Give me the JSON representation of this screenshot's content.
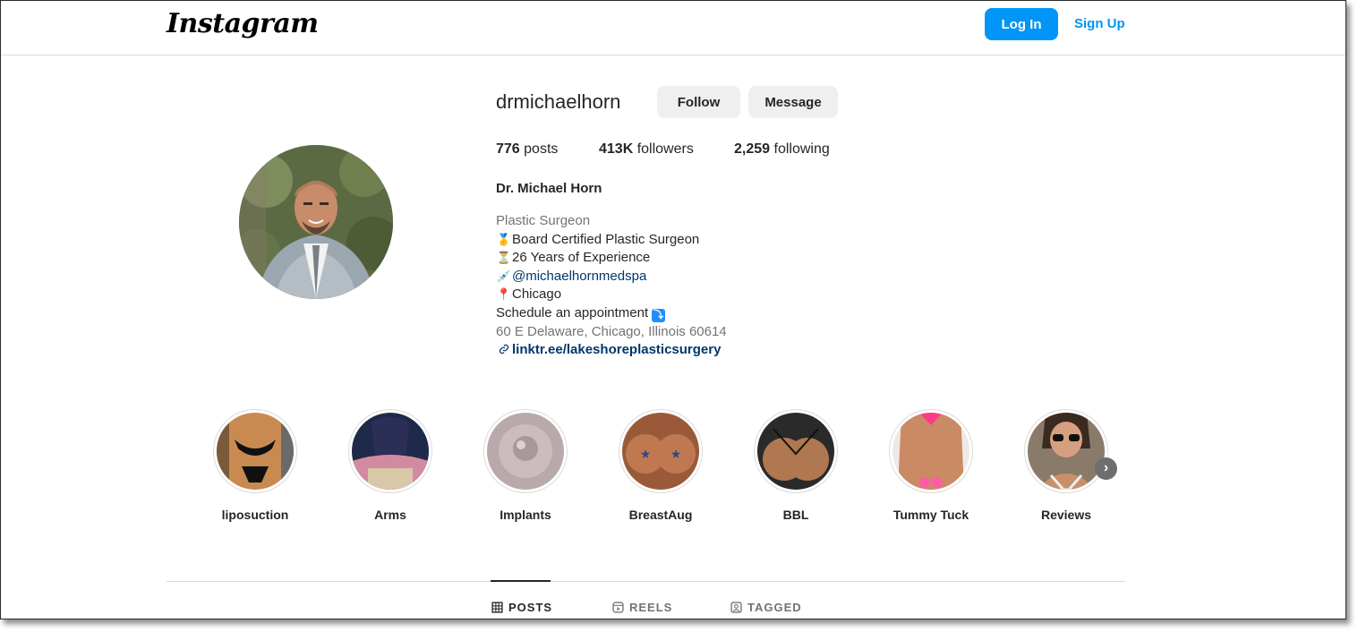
{
  "header": {
    "logo": "Instagram",
    "login_label": "Log In",
    "signup_label": "Sign Up"
  },
  "profile": {
    "username": "drmichaelhorn",
    "follow_label": "Follow",
    "message_label": "Message",
    "stats": {
      "posts_count": "776",
      "posts_label": "posts",
      "followers_count": "413K",
      "followers_label": "followers",
      "following_count": "2,259",
      "following_label": "following"
    },
    "full_name": "Dr. Michael Horn",
    "category": "Plastic Surgeon",
    "bio_lines": {
      "board": "Board Certified Plastic Surgeon",
      "experience": "26 Years of Experience",
      "medspa": "@michaelhornmedspa",
      "city": "Chicago",
      "schedule": "Schedule an appointment"
    },
    "address": "60 E Delaware, Chicago, Illinois 60614",
    "external_link": "linktr.ee/lakeshoreplasticsurgery"
  },
  "highlights": [
    {
      "label": "liposuction"
    },
    {
      "label": "Arms"
    },
    {
      "label": "Implants"
    },
    {
      "label": "BreastAug"
    },
    {
      "label": "BBL"
    },
    {
      "label": "Tummy Tuck"
    },
    {
      "label": "Reviews"
    }
  ],
  "tabs": [
    {
      "label": "POSTS",
      "active": true
    },
    {
      "label": "REELS",
      "active": false
    },
    {
      "label": "TAGGED",
      "active": false
    }
  ],
  "colors": {
    "accent": "#0095f6",
    "link": "#00376b",
    "muted": "#737373"
  }
}
